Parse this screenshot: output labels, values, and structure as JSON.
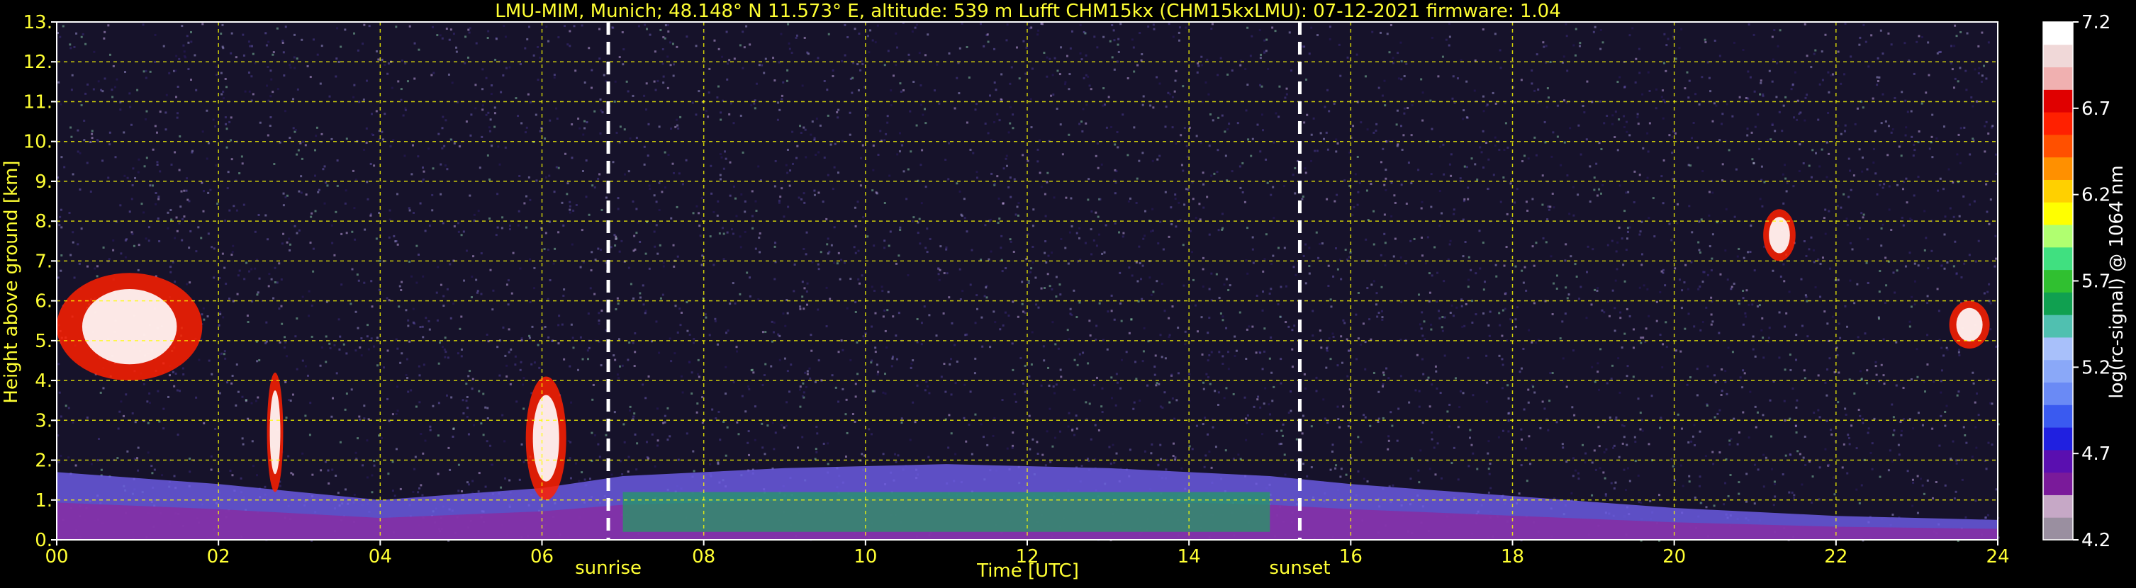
{
  "chart_data": {
    "type": "heatmap",
    "title": "LMU-MIM, Munich; 48.148° N 11.573° E, altitude: 539 m    Lufft CHM15kx (CHM15kxLMU): 07-12-2021    firmware: 1.04",
    "xlabel": "Time [UTC]",
    "ylabel": "Height above ground [km]",
    "xlim": [
      0,
      24
    ],
    "ylim": [
      0,
      13
    ],
    "x_ticks": [
      "00",
      "02",
      "04",
      "06",
      "08",
      "10",
      "12",
      "14",
      "16",
      "18",
      "20",
      "22",
      "24"
    ],
    "y_ticks": [
      "0.",
      "1.",
      "2.",
      "3.",
      "4.",
      "5.",
      "6.",
      "7.",
      "8.",
      "9.",
      "10.",
      "11.",
      "12.",
      "13."
    ],
    "grid": true,
    "grid_color": "#ffff00",
    "events": [
      {
        "label": "sunrise",
        "time": 6.82
      },
      {
        "label": "sunset",
        "time": 15.37
      }
    ],
    "colorbar": {
      "label": "log(rc-signal) @ 1064 nm",
      "range": [
        4.2,
        7.2
      ],
      "ticks": [
        "7.2",
        "6.7",
        "6.2",
        "5.7",
        "5.2",
        "4.7",
        "4.2"
      ],
      "colors": [
        "#9a8fa0",
        "#c6a8c6",
        "#7a1a9a",
        "#5a0fb0",
        "#2020e0",
        "#3a5af0",
        "#6a8af5",
        "#8aa8f8",
        "#a8c0fa",
        "#50c0b0",
        "#10a050",
        "#30c030",
        "#40e080",
        "#b0ff70",
        "#ffff00",
        "#ffd000",
        "#ff9000",
        "#ff5000",
        "#ff2000",
        "#e00000",
        "#f0b0b0",
        "#f0d8d8",
        "#ffffff"
      ]
    },
    "features": [
      {
        "kind": "boundary_layer",
        "time_start": 0,
        "time_end": 24,
        "top_km_points": [
          [
            0,
            1.7
          ],
          [
            2,
            1.4
          ],
          [
            4,
            1.0
          ],
          [
            6,
            1.3
          ],
          [
            7,
            1.6
          ],
          [
            9,
            1.8
          ],
          [
            11,
            1.9
          ],
          [
            13,
            1.8
          ],
          [
            15,
            1.6
          ],
          [
            16,
            1.4
          ],
          [
            18,
            1.1
          ],
          [
            20,
            0.8
          ],
          [
            22,
            0.6
          ],
          [
            24,
            0.5
          ]
        ]
      },
      {
        "kind": "cloud",
        "time_start": 0.0,
        "time_end": 1.8,
        "base_km": 4.0,
        "top_km": 6.7
      },
      {
        "kind": "cloud",
        "time_start": 2.6,
        "time_end": 2.8,
        "base_km": 1.2,
        "top_km": 4.2
      },
      {
        "kind": "cloud",
        "time_start": 5.8,
        "time_end": 6.3,
        "base_km": 1.0,
        "top_km": 4.1
      },
      {
        "kind": "cloud",
        "time_start": 21.1,
        "time_end": 21.5,
        "base_km": 7.0,
        "top_km": 8.3
      },
      {
        "kind": "cloud",
        "time_start": 23.4,
        "time_end": 23.9,
        "base_km": 4.8,
        "top_km": 6.0
      }
    ]
  }
}
